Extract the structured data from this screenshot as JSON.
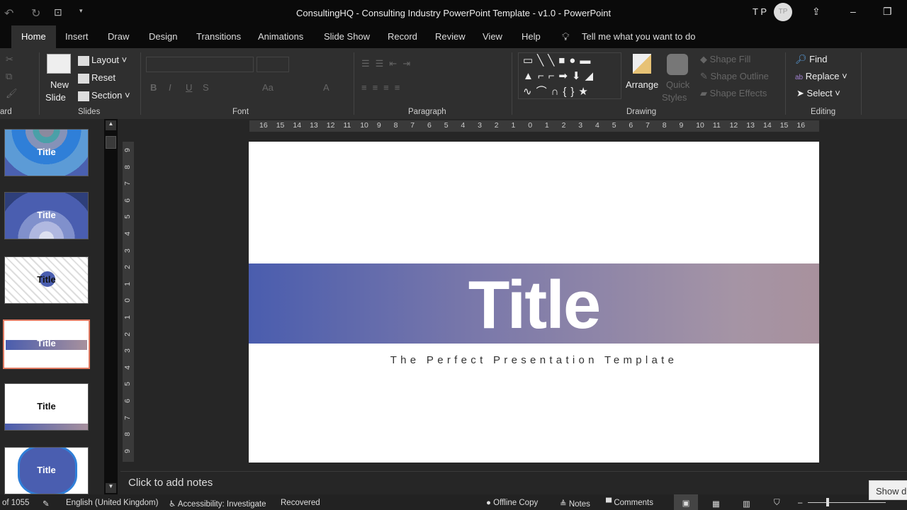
{
  "window": {
    "title": "ConsultingHQ - Consulting Industry PowerPoint Template - v1.0  -  PowerPoint",
    "user_initials": "T P",
    "avatar": "TP"
  },
  "tabs": [
    "Home",
    "Insert",
    "Draw",
    "Design",
    "Transitions",
    "Animations",
    "Slide Show",
    "Record",
    "Review",
    "View",
    "Help"
  ],
  "tell_me": "Tell me what you want to do",
  "ribbon": {
    "clipboard_label": "ard",
    "slides": {
      "new_slide_line1": "New",
      "new_slide_line2": "Slide",
      "layout": "Layout",
      "reset": "Reset",
      "section": "Section",
      "label": "Slides"
    },
    "font": {
      "bold": "B",
      "italic": "I",
      "underline": "U",
      "strike": "S",
      "case": "Aa",
      "color": "A",
      "label": "Font"
    },
    "paragraph": {
      "label": "Paragraph"
    },
    "drawing": {
      "arrange": "Arrange",
      "quick_styles_1": "Quick",
      "quick_styles_2": "Styles",
      "shape_fill": "Shape Fill",
      "shape_outline": "Shape Outline",
      "shape_effects": "Shape Effects",
      "label": "Drawing"
    },
    "editing": {
      "find": "Find",
      "replace": "Replace",
      "select": "Select",
      "label": "Editing"
    }
  },
  "thumbnails": [
    {
      "title": "Title"
    },
    {
      "title": "Title"
    },
    {
      "title": "Title"
    },
    {
      "title": "Title",
      "selected": true
    },
    {
      "title": "Title"
    },
    {
      "title": "Title"
    }
  ],
  "hruler": [
    "16",
    "15",
    "14",
    "13",
    "12",
    "11",
    "10",
    "9",
    "8",
    "7",
    "6",
    "5",
    "4",
    "3",
    "2",
    "1",
    "0",
    "1",
    "2",
    "3",
    "4",
    "5",
    "6",
    "7",
    "8",
    "9",
    "10",
    "11",
    "12",
    "13",
    "14",
    "15",
    "16"
  ],
  "vruler": [
    "9",
    "8",
    "7",
    "6",
    "5",
    "4",
    "3",
    "2",
    "1",
    "0",
    "1",
    "2",
    "3",
    "4",
    "5",
    "6",
    "7",
    "8",
    "9"
  ],
  "slide": {
    "title": "Title",
    "subtitle": "The Perfect Presentation Template",
    "gradient_start": "#4a5dae",
    "gradient_end": "#a8919d"
  },
  "notes_placeholder": "Click to add notes",
  "status": {
    "slide_count": "of 1055",
    "language": "English (United Kingdom)",
    "accessibility": "Accessibility: Investigate",
    "recovered": "Recovered",
    "offline": "Offline Copy",
    "notes": "Notes",
    "comments": "Comments",
    "tooltip": "Show d"
  }
}
